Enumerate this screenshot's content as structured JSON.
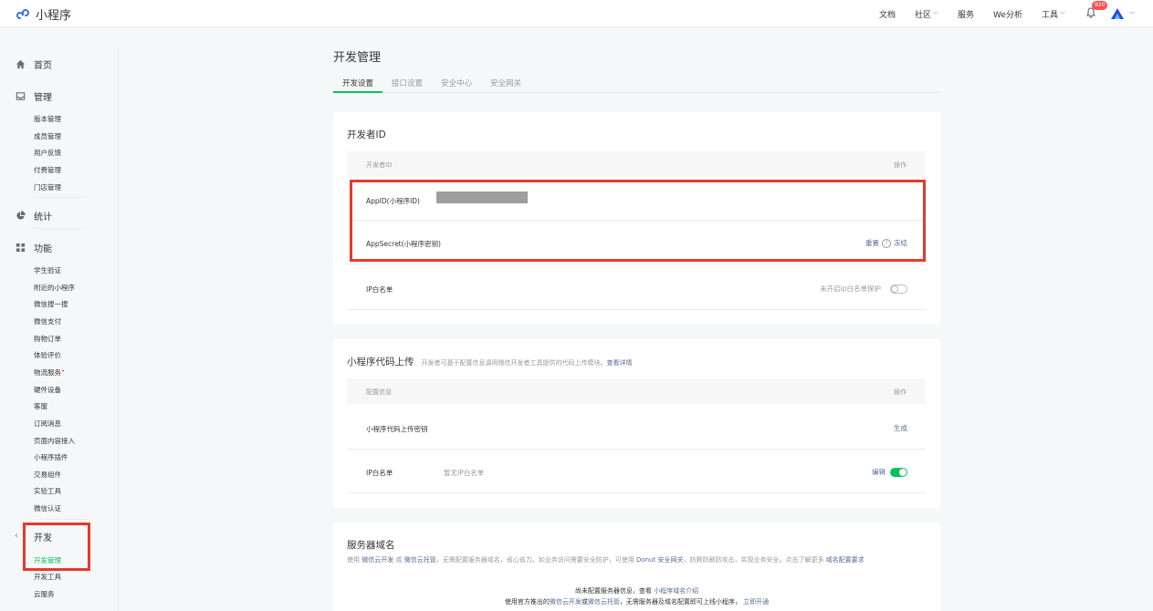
{
  "header": {
    "app_name": "小程序",
    "nav": [
      {
        "label": "文档",
        "has_dropdown": false
      },
      {
        "label": "社区",
        "has_dropdown": true
      },
      {
        "label": "服务",
        "has_dropdown": false
      },
      {
        "label": "We分析",
        "has_dropdown": false
      },
      {
        "label": "工具",
        "has_dropdown": true
      }
    ],
    "notification_count": "920"
  },
  "sidebar": {
    "home": "首页",
    "manage": {
      "label": "管理",
      "items": [
        "版本管理",
        "成员管理",
        "用户反馈",
        "付费管理",
        "门店管理"
      ]
    },
    "stats": "统计",
    "features": {
      "label": "功能",
      "items": [
        "学生验证",
        "附近的小程序",
        "微信搜一搜",
        "微信支付",
        "购物订单",
        "体验评价",
        "物流服务",
        "硬件设备",
        "客服",
        "订阅消息",
        "页面内容接入",
        "小程序插件",
        "交易组件",
        "实验工具",
        "微信认证"
      ]
    },
    "develop": {
      "label": "开发",
      "items": [
        "开发管理",
        "开发工具",
        "云服务"
      ],
      "active": "开发管理"
    }
  },
  "page": {
    "title": "开发管理",
    "tabs": [
      "开发设置",
      "接口设置",
      "安全中心",
      "安全网关"
    ],
    "active_tab": "开发设置"
  },
  "dev_id_card": {
    "title": "开发者ID",
    "col_name": "开发者ID",
    "col_action": "操作",
    "appid_label": "AppID(小程序ID)",
    "appsecret_label": "AppSecret(小程序密钥)",
    "reset": "重置",
    "freeze": "冻结",
    "ip_label": "IP白名单",
    "ip_status": "未开启ip白名单保护"
  },
  "upload_card": {
    "title": "小程序代码上传",
    "desc": "开发者可基于配置信息调用微信开发者工具提供的代码上传模块。",
    "desc_link": "查看详情",
    "col_name": "配置信息",
    "col_action": "操作",
    "key_label": "小程序代码上传密钥",
    "generate": "生成",
    "ip_label": "IP白名单",
    "ip_value": "暂无IP白名单",
    "edit": "编辑"
  },
  "server_card": {
    "title": "服务器域名",
    "desc_parts": [
      "使用",
      "微信云开发",
      "或",
      "微信云托管",
      "，无需配置服务器域名，省心省力。如业务访问需要安全防护，可使用",
      "Donut 安全网关",
      "，防爬防刷防攻击，实现业务安全。点击了解更多",
      "域名配置要求"
    ],
    "line1": "尚未配置服务器信息，查看",
    "line1_link": "小程序域名介绍",
    "line2_parts": [
      "使用官方推出的",
      "微信云开发",
      "或",
      "微信云托管",
      "，无需服务器及域名配置即可上线小程序，",
      "立即开通"
    ]
  },
  "colors": {
    "accent_green": "#07c160",
    "link_blue": "#576b95",
    "highlight_red": "#e53a2a",
    "badge_red": "#fa5151"
  }
}
